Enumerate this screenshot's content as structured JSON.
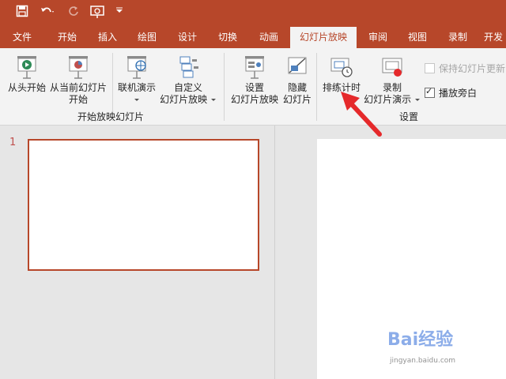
{
  "colors": {
    "accent": "#b7472a",
    "ribbon_bg": "#f3f3f3",
    "workspace_bg": "#e6e6e6",
    "arrow": "#e5292b"
  },
  "qat": {
    "icons": [
      "save-icon",
      "undo-icon",
      "redo-icon",
      "present-from-start-icon",
      "customize-qat-icon"
    ]
  },
  "tabs": [
    {
      "label": "文件"
    },
    {
      "label": "开始"
    },
    {
      "label": "插入"
    },
    {
      "label": "绘图"
    },
    {
      "label": "设计"
    },
    {
      "label": "切换"
    },
    {
      "label": "动画"
    },
    {
      "label": "幻灯片放映"
    },
    {
      "label": "审阅"
    },
    {
      "label": "视图"
    },
    {
      "label": "录制"
    },
    {
      "label": "开发"
    }
  ],
  "ribbon": {
    "start": {
      "from_beginning": "从头开始",
      "from_current_1": "从当前幻灯片",
      "from_current_2": "开始",
      "online": "联机演示",
      "custom_1": "自定义",
      "custom_2": "幻灯片放映",
      "group_label": "开始放映幻灯片"
    },
    "setup": {
      "setup_1": "设置",
      "setup_2": "幻灯片放映",
      "hide_1": "隐藏",
      "hide_2": "幻灯片",
      "rehearse": "排练计时",
      "record_1": "录制",
      "record_2": "幻灯片演示",
      "keep_updated": "保持幻灯片更新",
      "play_narrations": "播放旁白",
      "group_label": "设置"
    }
  },
  "slides": {
    "thumb_number": "1"
  },
  "watermark": {
    "main": "Bai经验",
    "sub": "jingyan.baidu.com"
  }
}
